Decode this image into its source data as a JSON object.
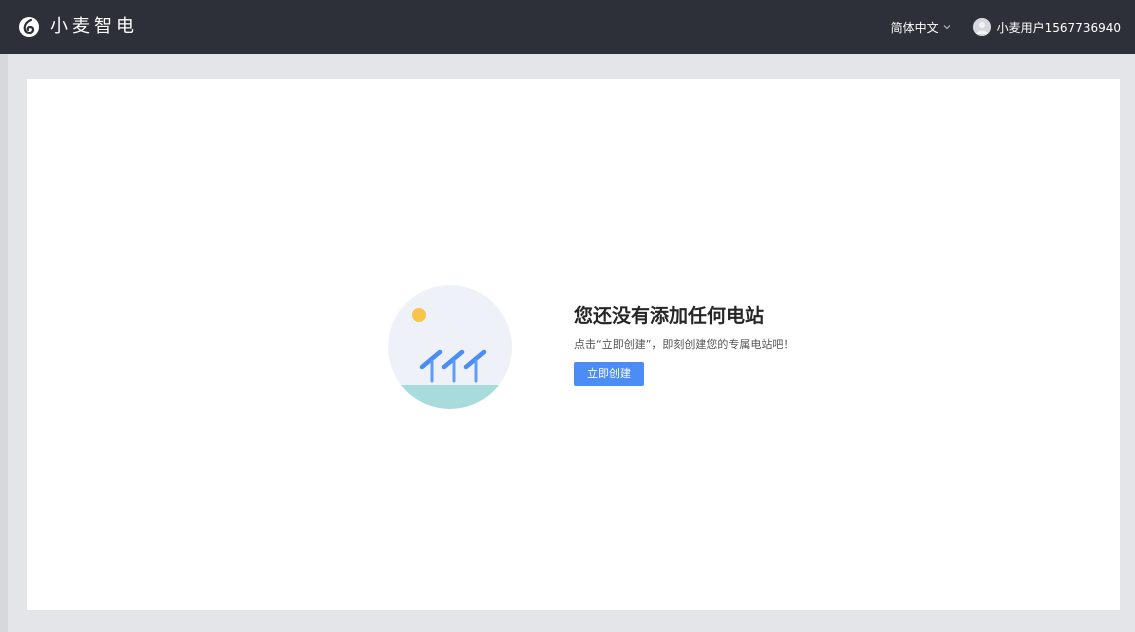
{
  "header": {
    "app_name": "小麦智电",
    "language": "简体中文",
    "username": "小麦用户1567736940"
  },
  "empty_state": {
    "title": "您还没有添加任何电站",
    "description": "点击“立即创建”，即刻创建您的专属电站吧！",
    "create_button_label": "立即创建"
  },
  "colors": {
    "header_bg": "#2e3039",
    "page_bg": "#e4e5e9",
    "accent": "#4b8cf5",
    "sun": "#f7c54a",
    "ground": "#a8dcdc"
  },
  "icons": [
    "logo-icon",
    "chevron-down-icon",
    "avatar-icon",
    "solar-panels-illustration"
  ]
}
